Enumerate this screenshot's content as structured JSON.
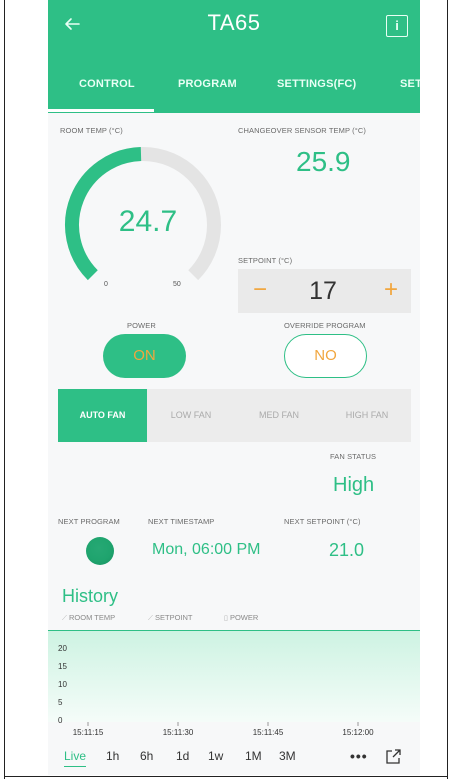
{
  "header": {
    "title": "TA65",
    "back_icon": "back-arrow-icon",
    "info_icon": "info-icon"
  },
  "tabs": [
    {
      "label": "CONTROL",
      "active": true
    },
    {
      "label": "PROGRAM",
      "active": false
    },
    {
      "label": "SETTINGS(FC)",
      "active": false
    },
    {
      "label": "SET",
      "active": false
    }
  ],
  "room_temp": {
    "label": "ROOM TEMP (°C)",
    "value": "24.7",
    "min": "0",
    "max": "50",
    "fraction": 0.494
  },
  "changeover": {
    "label": "CHANGEOVER SENSOR TEMP (°C)",
    "value": "25.9"
  },
  "setpoint": {
    "label": "SETPOINT (°C)",
    "value": "17",
    "minus": "−",
    "plus": "+"
  },
  "power": {
    "label": "POWER",
    "value": "ON"
  },
  "override": {
    "label": "OVERRIDE PROGRAM",
    "value": "NO"
  },
  "fan_modes": [
    {
      "label": "AUTO FAN",
      "active": true
    },
    {
      "label": "LOW FAN",
      "active": false
    },
    {
      "label": "MED FAN",
      "active": false
    },
    {
      "label": "HIGH FAN",
      "active": false
    }
  ],
  "fan_status": {
    "label": "FAN STATUS",
    "value": "High"
  },
  "next_program": {
    "label": "NEXT PROGRAM"
  },
  "next_timestamp": {
    "label": "NEXT TIMESTAMP",
    "value": "Mon, 06:00 PM"
  },
  "next_setpoint": {
    "label": "NEXT SETPOINT (°C)",
    "value": "21.0"
  },
  "history": {
    "title": "History",
    "legend": [
      {
        "mark": "⟋",
        "label": "ROOM TEMP"
      },
      {
        "mark": "⟋",
        "label": "SETPOINT"
      },
      {
        "mark": "▯",
        "label": "POWER"
      }
    ],
    "time_ranges": [
      "Live",
      "1h",
      "6h",
      "1d",
      "1w",
      "1M",
      "3M"
    ],
    "active_range": "Live",
    "more_label": "•••"
  },
  "chart_data": {
    "type": "area",
    "y_ticks": [
      "20",
      "15",
      "10",
      "5",
      "0"
    ],
    "x_ticks": [
      "15:11:15",
      "15:11:30",
      "15:11:45",
      "15:12:00"
    ],
    "ylim": [
      0,
      20
    ],
    "series": [],
    "grid": false,
    "legend": "top-left"
  },
  "colors": {
    "accent": "#2ebf86",
    "orange": "#f1a63e"
  }
}
